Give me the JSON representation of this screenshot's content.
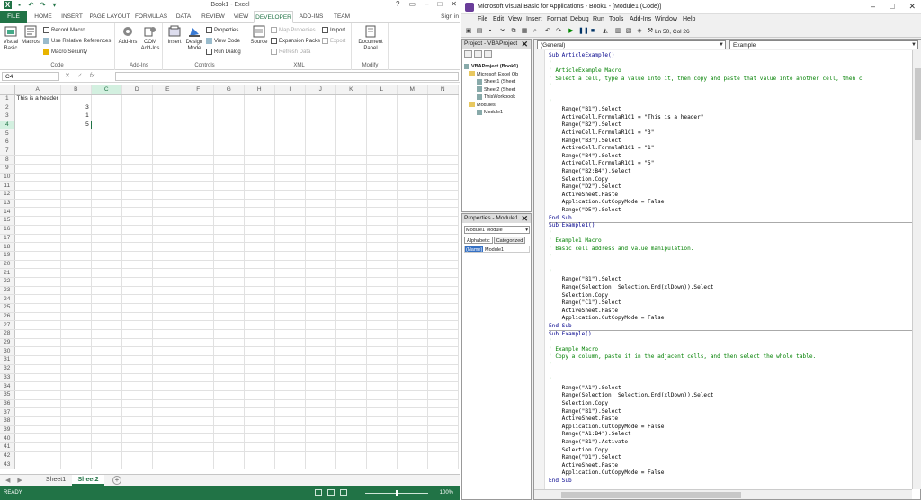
{
  "excel": {
    "title": "Book1 - Excel",
    "signin": "Sign in",
    "tabs": [
      "FILE",
      "HOME",
      "INSERT",
      "PAGE LAYOUT",
      "FORMULAS",
      "DATA",
      "REVIEW",
      "VIEW",
      "DEVELOPER",
      "ADD-INS",
      "TEAM"
    ],
    "active_tab": "DEVELOPER",
    "ribbon": {
      "code": {
        "label": "Code",
        "visual_basic": "Visual Basic",
        "macros": "Macros",
        "record_macro": "Record Macro",
        "relative_refs": "Use Relative References",
        "macro_security": "Macro Security"
      },
      "addins": {
        "label": "Add-Ins",
        "addins": "Add-Ins",
        "com_addins": "COM Add-Ins"
      },
      "controls": {
        "label": "Controls",
        "insert": "Insert",
        "design_mode": "Design Mode",
        "properties": "Properties",
        "view_code": "View Code",
        "run_dialog": "Run Dialog"
      },
      "xml": {
        "label": "XML",
        "source": "Source",
        "map_properties": "Map Properties",
        "expansion_packs": "Expansion Packs",
        "refresh_data": "Refresh Data",
        "import": "Import",
        "export": "Export"
      },
      "modify": {
        "label": "Modify",
        "document_panel": "Document Panel"
      }
    },
    "name_box": "C4",
    "columns": [
      "A",
      "B",
      "C",
      "D",
      "E",
      "F",
      "G",
      "H",
      "I",
      "J",
      "K",
      "L",
      "M",
      "N"
    ],
    "rows": 43,
    "cells": {
      "A1": "This is a header",
      "B2": "3",
      "B3": "1",
      "B4": "5"
    },
    "sheets": [
      "Sheet1",
      "Sheet2"
    ],
    "active_sheet": "Sheet2",
    "status": "READY",
    "zoom": "100%"
  },
  "vba": {
    "title": "Microsoft Visual Basic for Applications - Book1 - [Module1 (Code)]",
    "menu": [
      "File",
      "Edit",
      "View",
      "Insert",
      "Format",
      "Debug",
      "Run",
      "Tools",
      "Add-Ins",
      "Window",
      "Help"
    ],
    "cursor_pos": "Ln 50, Col 26",
    "project_panel": {
      "title": "Project - VBAProject",
      "tree": [
        {
          "label": "VBAProject (Book1)",
          "level": 0
        },
        {
          "label": "Microsoft Excel Ob",
          "level": 1
        },
        {
          "label": "Sheet1 (Sheet",
          "level": 2
        },
        {
          "label": "Sheet2 (Sheet",
          "level": 2
        },
        {
          "label": "ThisWorkbook",
          "level": 2
        },
        {
          "label": "Modules",
          "level": 1
        },
        {
          "label": "Module1",
          "level": 2
        }
      ]
    },
    "properties_panel": {
      "title": "Properties - Module1",
      "object": "Module1  Module",
      "tabs": [
        "Alphabetic",
        "Categorized"
      ],
      "prop_name": "(Name)",
      "prop_value": "Module1"
    },
    "combo_left": "(General)",
    "combo_right": "Example",
    "code_lines": [
      "Sub ArticleExample()",
      "'",
      "' ArticleExample Macro",
      "' Select a cell, type a value into it, then copy and paste that value into another cell, then c",
      "'",
      "",
      "'",
      "    Range(\"B1\").Select",
      "    ActiveCell.FormulaR1C1 = \"This is a header\"",
      "    Range(\"B2\").Select",
      "    ActiveCell.FormulaR1C1 = \"3\"",
      "    Range(\"B3\").Select",
      "    ActiveCell.FormulaR1C1 = \"1\"",
      "    Range(\"B4\").Select",
      "    ActiveCell.FormulaR1C1 = \"5\"",
      "    Range(\"B2:B4\").Select",
      "    Selection.Copy",
      "    Range(\"D2\").Select",
      "    ActiveSheet.Paste",
      "    Application.CutCopyMode = False",
      "    Range(\"D5\").Select",
      "End Sub",
      "Sub Example1()",
      "'",
      "' Example1 Macro",
      "' Basic cell address and value manipulation.",
      "'",
      "",
      "'",
      "    Range(\"B1\").Select",
      "    Range(Selection, Selection.End(xlDown)).Select",
      "    Selection.Copy",
      "    Range(\"C1\").Select",
      "    ActiveSheet.Paste",
      "    Application.CutCopyMode = False",
      "End Sub",
      "Sub Example()",
      "'",
      "' Example Macro",
      "' Copy a column, paste it in the adjacent cells, and then select the whole table.",
      "'",
      "",
      "'",
      "    Range(\"A1\").Select",
      "    Range(Selection, Selection.End(xlDown)).Select",
      "    Selection.Copy",
      "    Range(\"B1\").Select",
      "    ActiveSheet.Paste",
      "    Application.CutCopyMode = False",
      "    Range(\"A1:B4\").Select",
      "    Range(\"B1\").Activate",
      "    Selection.Copy",
      "    Range(\"D1\").Select",
      "    ActiveSheet.Paste",
      "    Application.CutCopyMode = False",
      "End Sub"
    ]
  }
}
